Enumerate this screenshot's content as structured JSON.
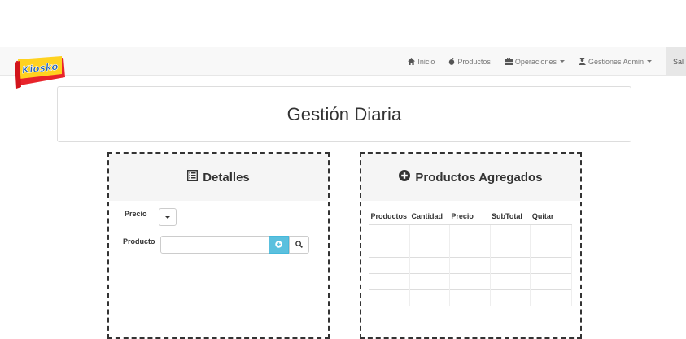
{
  "logo": {
    "text": "Kiosko"
  },
  "nav": {
    "items": [
      {
        "label": "Inicio",
        "icon": "home-icon"
      },
      {
        "label": "Productos",
        "icon": "apple-icon"
      },
      {
        "label": "Operaciones",
        "icon": "briefcase-icon",
        "dropdown": true
      },
      {
        "label": "Gestiones Admin",
        "icon": "user-icon",
        "dropdown": true
      }
    ],
    "tail": "Sal"
  },
  "page": {
    "title": "Gestión Diaria"
  },
  "detalles": {
    "heading": "Detalles",
    "precio_label": "Precio",
    "producto_label": "Producto",
    "producto_value": ""
  },
  "agregados": {
    "heading": "Productos Agregados",
    "columns": [
      "Productos",
      "Cantidad",
      "Precio",
      "SubTotal",
      "Quitar"
    ],
    "rows": [
      [
        "",
        "",
        "",
        "",
        ""
      ],
      [
        "",
        "",
        "",
        "",
        ""
      ],
      [
        "",
        "",
        "",
        "",
        ""
      ],
      [
        "",
        "",
        "",
        "",
        ""
      ],
      [
        "",
        "",
        "",
        "",
        ""
      ]
    ]
  },
  "colors": {
    "accent": "#5bc0de",
    "navbar": "#f8f8f8"
  }
}
